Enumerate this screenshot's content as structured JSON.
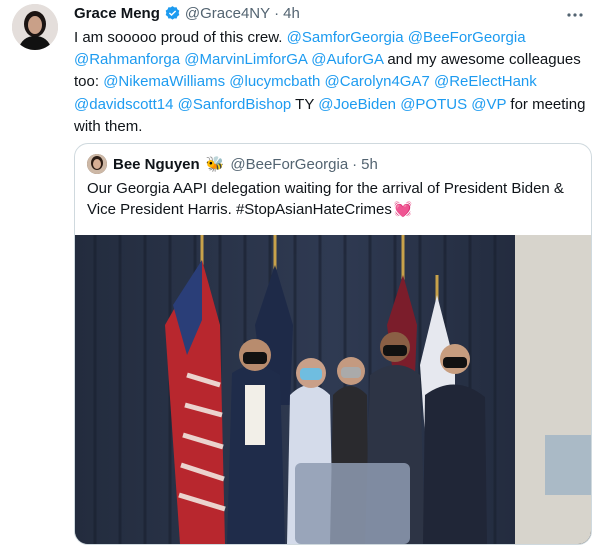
{
  "tweet": {
    "author_name": "Grace Meng",
    "handle": "@Grace4NY",
    "separator": "·",
    "time": "4h",
    "more_icon": "more-horizontal-icon",
    "verified_icon": "verified-badge-icon",
    "text_parts": [
      {
        "t": "I am sooooo proud of this crew. ",
        "m": false
      },
      {
        "t": "@SamforGeorgia",
        "m": true
      },
      {
        "t": " ",
        "m": false
      },
      {
        "t": "@BeeForGeorgia",
        "m": true
      },
      {
        "t": " ",
        "m": false
      },
      {
        "t": "@Rahmanforga",
        "m": true
      },
      {
        "t": " ",
        "m": false
      },
      {
        "t": "@MarvinLimforGA",
        "m": true
      },
      {
        "t": " ",
        "m": false
      },
      {
        "t": "@AuforGA",
        "m": true
      },
      {
        "t": " and my awesome colleagues too: ",
        "m": false
      },
      {
        "t": "@NikemaWilliams",
        "m": true
      },
      {
        "t": " ",
        "m": false
      },
      {
        "t": "@lucymcbath",
        "m": true
      },
      {
        "t": " ",
        "m": false
      },
      {
        "t": "@Carolyn4GA7",
        "m": true
      },
      {
        "t": " ",
        "m": false
      },
      {
        "t": "@ReElectHank",
        "m": true
      },
      {
        "t": " ",
        "m": false
      },
      {
        "t": "@davidscott14",
        "m": true
      },
      {
        "t": " ",
        "m": false
      },
      {
        "t": "@SanfordBishop",
        "m": true
      },
      {
        "t": " TY ",
        "m": false
      },
      {
        "t": "@JoeBiden",
        "m": true
      },
      {
        "t": " ",
        "m": false
      },
      {
        "t": "@POTUS",
        "m": true
      },
      {
        "t": " ",
        "m": false
      },
      {
        "t": "@VP",
        "m": true
      },
      {
        "t": " for meeting with them.",
        "m": false
      }
    ]
  },
  "quote": {
    "author_name": "Bee Nguyen",
    "bee_emoji": "🐝",
    "handle": "@BeeForGeorgia",
    "separator": "·",
    "time": "5h",
    "text": "Our Georgia AAPI delegation waiting for the arrival of President Biden & Vice President Harris. #StopAsianHateCrimes",
    "heart_emoji": "💓"
  },
  "colors": {
    "link": "#1d9bf0",
    "secondary_text": "#536471",
    "border": "#cfd9de",
    "curtain": "#2b3446"
  }
}
